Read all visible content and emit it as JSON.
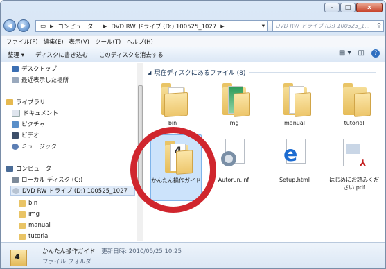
{
  "window": {
    "minimize_label": "–",
    "maximize_label": "□",
    "close_label": "x"
  },
  "address": {
    "segments": [
      "コンピューター",
      "DVD RW ドライブ (D:) 100525_1027"
    ],
    "search_placeholder": "DVD RW ドライブ (D:) 100525_1..."
  },
  "menu": [
    "ファイル(F)",
    "編集(E)",
    "表示(V)",
    "ツール(T)",
    "ヘルプ(H)"
  ],
  "toolbar": {
    "organize": "整理 ▾",
    "burn": "ディスクに書き込む",
    "erase": "このディスクを消去する"
  },
  "nav": {
    "desktop": "デスクトップ",
    "recent": "最近表示した場所",
    "libraries": "ライブラリ",
    "documents": "ドキュメント",
    "pictures": "ピクチャ",
    "videos": "ビデオ",
    "music": "ミュージック",
    "computer": "コンピューター",
    "local_disk": "ローカル ディスク (C:)",
    "dvd": "DVD RW ドライブ (D:) 100525_1027",
    "folders": [
      "bin",
      "img",
      "manual",
      "tutorial"
    ]
  },
  "content": {
    "group_header": "現在ディスクにあるファイル (8)",
    "files": [
      {
        "name": "bin",
        "type": "folder"
      },
      {
        "name": "img",
        "type": "folder"
      },
      {
        "name": "manual",
        "type": "folder"
      },
      {
        "name": "tutorial",
        "type": "folder"
      },
      {
        "name": "かんたん操作ガイド",
        "type": "folder"
      },
      {
        "name": "Autorun.inf",
        "type": "settings"
      },
      {
        "name": "Setup.html",
        "type": "html"
      },
      {
        "name": "はじめにお読みください.pdf",
        "type": "pdf"
      }
    ]
  },
  "details": {
    "name": "かんたん操作ガイド",
    "meta": "更新日時: 2010/05/25 10:25",
    "type": "ファイル フォルダー"
  },
  "colors": {
    "highlight_circle": "#d0262e",
    "selection": "#cce3fb"
  }
}
